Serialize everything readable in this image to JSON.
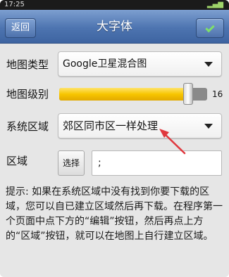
{
  "status_bar": {
    "time": "17:25"
  },
  "header": {
    "back_label": "返回",
    "title": "大字体",
    "done_icon": "check-icon"
  },
  "form": {
    "map_type": {
      "label": "地图类型",
      "value": "Google卫星混合图"
    },
    "map_level": {
      "label": "地图级别",
      "value": 16,
      "level_fraction": 0.87
    },
    "system_area": {
      "label": "系统区域",
      "value": "郊区同市区一样处理"
    },
    "area": {
      "label": "区域",
      "select_label": "选择",
      "value": ";"
    }
  },
  "hint": "提示: 如果在系统区域中没有找到你要下载的区域，您可以自已建立区域然后再下载。在程序第一个页面中点下方的“编辑”按钮，然后再点上方的“区域”按钮，就可以在地图上自行建立区域。",
  "colors": {
    "accent": "#4d74b0",
    "slider_fill": "#f7c500",
    "annotation_arrow": "#e0383e"
  }
}
